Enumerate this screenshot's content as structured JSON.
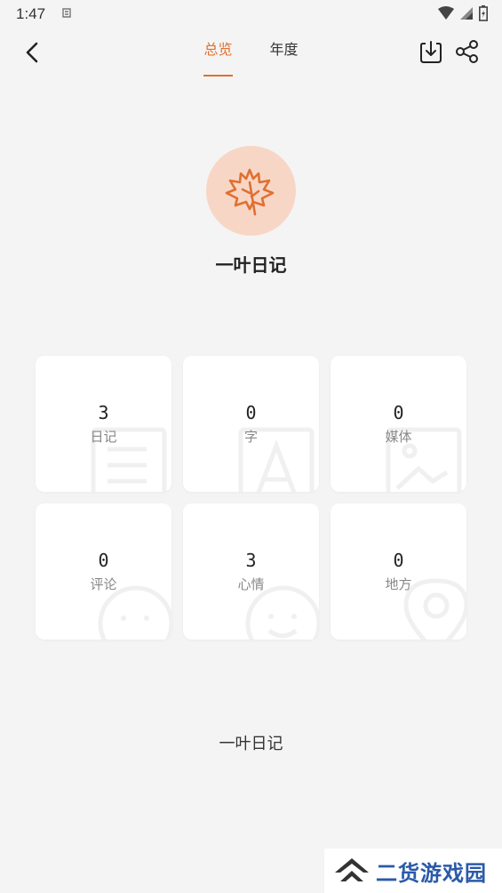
{
  "status_bar": {
    "time": "1:47",
    "icons": [
      "notification-icon",
      "wifi-icon",
      "signal-icon",
      "battery-icon"
    ]
  },
  "top_bar": {
    "tabs": [
      {
        "label": "总览",
        "active": true
      },
      {
        "label": "年度",
        "active": false
      }
    ],
    "icons": [
      "back-icon",
      "export-icon",
      "share-icon"
    ]
  },
  "app": {
    "name": "一叶日记",
    "logo_icon": "maple-leaf-icon",
    "accent_color": "#e07030",
    "logo_bg_color": "#f8d6c6"
  },
  "stats": [
    {
      "value": "3",
      "label": "日记",
      "icon": "document-icon"
    },
    {
      "value": "0",
      "label": "字",
      "icon": "text-icon"
    },
    {
      "value": "0",
      "label": "媒体",
      "icon": "image-icon"
    },
    {
      "value": "0",
      "label": "评论",
      "icon": "face-icon"
    },
    {
      "value": "3",
      "label": "心情",
      "icon": "smile-icon"
    },
    {
      "value": "0",
      "label": "地方",
      "icon": "location-icon"
    }
  ],
  "footer": {
    "text": "一叶日记"
  },
  "watermark": {
    "text": "二货游戏园"
  }
}
